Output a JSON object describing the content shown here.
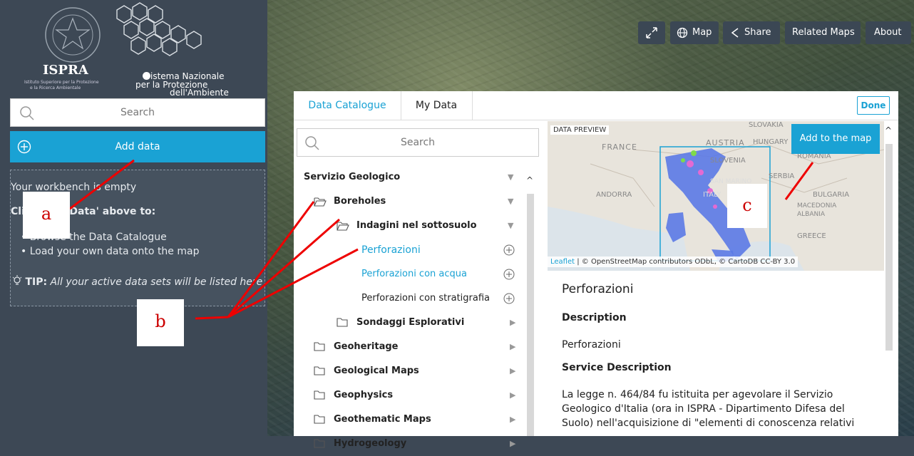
{
  "map_toolbar": {
    "map_label": "Map",
    "share_label": "Share",
    "related_label": "Related Maps",
    "about_label": "About"
  },
  "logos": {
    "ispra_title": "ISPRA",
    "ispra_sub1": "Istituto Superiore per la Protezione",
    "ispra_sub2": "e la Ricerca Ambientale",
    "snpa_line1": "istema Nazionale",
    "snpa_line2": "per la Protezione",
    "snpa_line3": "dell'Ambiente"
  },
  "left": {
    "search_placeholder": "Search",
    "add_data_label": "Add data",
    "workbench": {
      "empty_text": "Your workbench is empty",
      "click_text": "Click 'Add Data' above to:",
      "item1": "• Browse the Data Catalogue",
      "item2": "• Load your own data onto the map",
      "tip_label": "TIP:",
      "tip_text": "All your active data sets will be listed here"
    }
  },
  "dialog": {
    "tab_catalogue": "Data Catalogue",
    "tab_mydata": "My Data",
    "done_label": "Done",
    "search_placeholder": "Search",
    "tree": {
      "root": "Servizio Geologico",
      "boreholes": "Boreholes",
      "indagini": "Indagini nel sottosuolo",
      "perforazioni": "Perforazioni",
      "perf_acqua": "Perforazioni con acqua",
      "perf_strat": "Perforazioni con stratigrafia",
      "sondaggi": "Sondaggi Esplorativi",
      "geoheritage": "Geoheritage",
      "geological_maps": "Geological Maps",
      "geophysics": "Geophysics",
      "geothematic": "Geothematic Maps",
      "hydrogeology": "Hydrogeology"
    },
    "preview": {
      "label": "DATA PREVIEW",
      "add_to_map": "Add to the map",
      "attribution_leaflet": "Leaflet",
      "attribution_rest": " | © OpenStreetMap contributors ODbL, © CartoDB CC-BY 3.0",
      "map_labels": [
        "FRANCE",
        "AUSTRIA",
        "HUNGARY",
        "SLOVAKIA",
        "SLOVENIA",
        "ROMANIA",
        "SERBIA",
        "ANDORRA",
        "ITALY",
        "SAN MARINO",
        "BULGARIA",
        "MACEDONIA",
        "GREECE",
        "ALBANIA"
      ],
      "title": "Perforazioni",
      "description_h": "Description",
      "description": "Perforazioni",
      "service_h": "Service Description",
      "service_text": "La legge n. 464/84 fu istituita per agevolare il Servizio Geologico d'Italia (ora in ISPRA - Dipartimento Difesa del Suolo) nell'acquisizione di \"elementi di conoscenza relativi"
    }
  },
  "annotations": {
    "a": "a",
    "b": "b",
    "c": "c"
  },
  "colors": {
    "accent": "#1aa2d4",
    "panel": "#3d4855",
    "annotation_red": "#cc0000",
    "data_blue": "#5b79e6"
  }
}
